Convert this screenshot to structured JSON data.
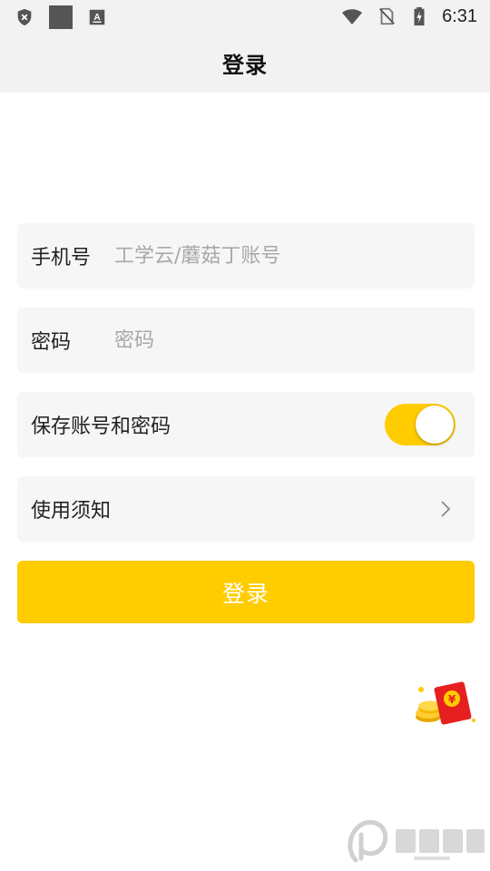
{
  "status_bar": {
    "time": "6:31",
    "icons": [
      "shield-x-icon",
      "square-icon",
      "keyboard-a-icon",
      "wifi-icon",
      "no-sim-icon",
      "battery-charging-icon"
    ]
  },
  "header": {
    "title": "登录"
  },
  "form": {
    "phone": {
      "label": "手机号",
      "placeholder": "工学云/蘑菇丁账号",
      "value": ""
    },
    "password": {
      "label": "密码",
      "placeholder": "密码",
      "value": ""
    },
    "save_credentials": {
      "label": "保存账号和密码",
      "enabled": true
    },
    "terms": {
      "label": "使用须知",
      "icon": "chevron-right-icon"
    },
    "login_button_label": "登录"
  },
  "floating": {
    "icon": "red-packet-icon"
  },
  "colors": {
    "accent": "#ffcc00",
    "card_bg": "#f6f6f6",
    "header_bg": "#f2f2f2",
    "text": "#222222",
    "placeholder": "#a8a8a8"
  }
}
